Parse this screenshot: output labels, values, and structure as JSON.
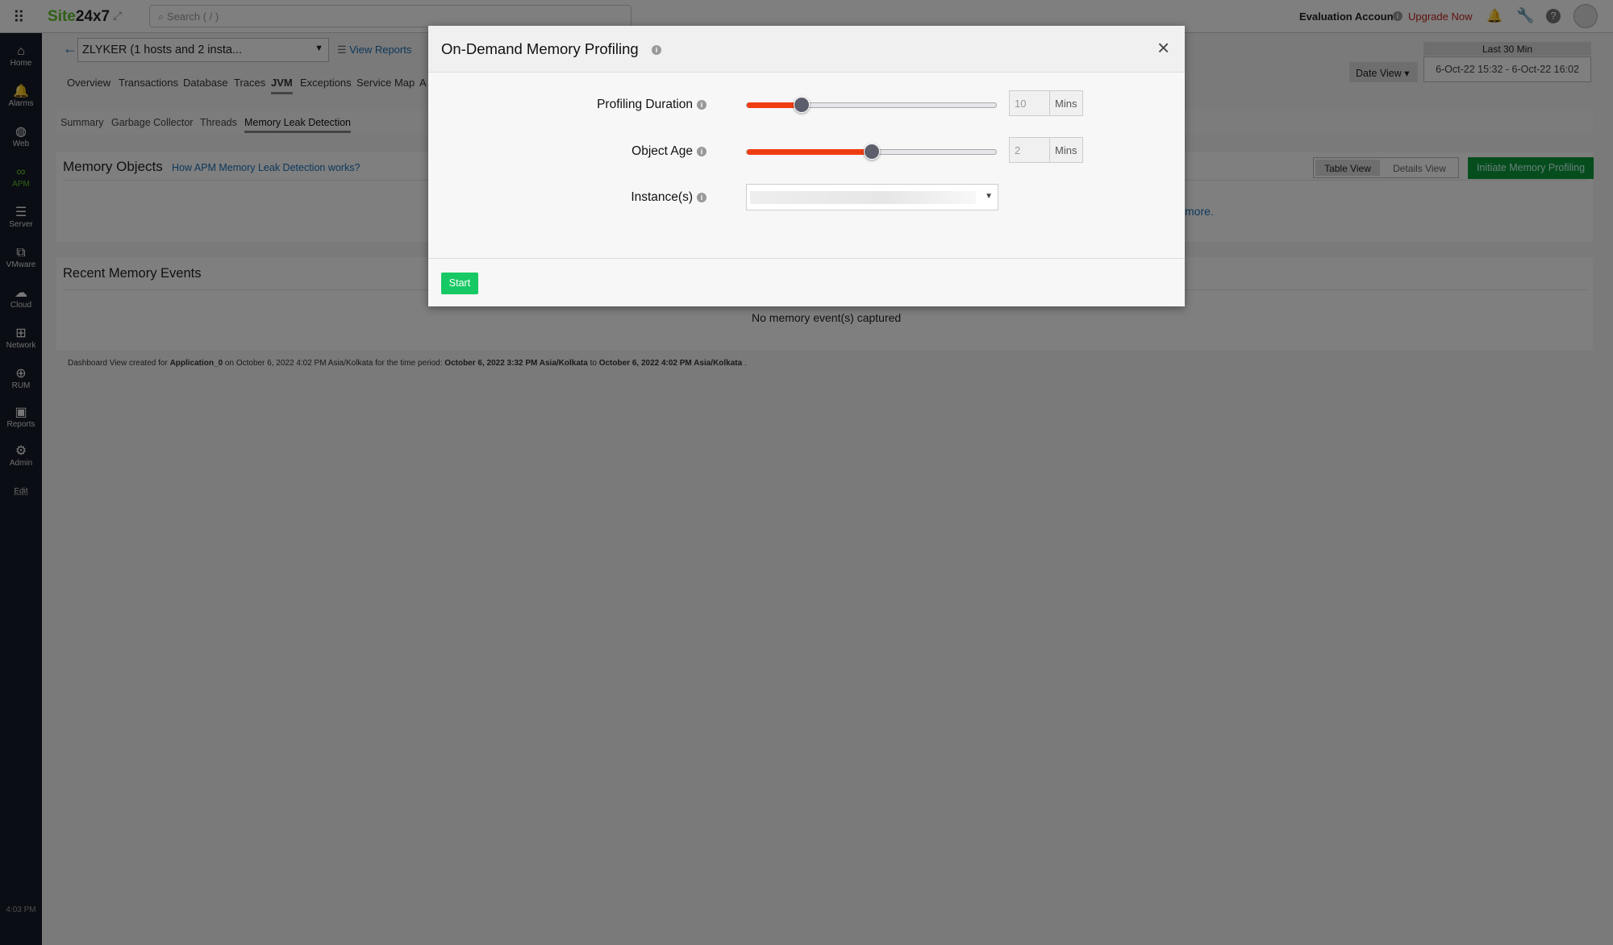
{
  "topbar": {
    "brand_a": "Site",
    "brand_b": "24x7",
    "search_placeholder": "Search ( / )",
    "account": "Evaluation Account",
    "upgrade": "Upgrade Now"
  },
  "sidebar": {
    "items": [
      {
        "label": "Home",
        "icon": "home-icon",
        "glyph": "⌂"
      },
      {
        "label": "Alarms",
        "icon": "bell-icon",
        "glyph": "🔔"
      },
      {
        "label": "Web",
        "icon": "globe-icon",
        "glyph": "◍"
      },
      {
        "label": "APM",
        "icon": "binoculars-icon",
        "glyph": "∞"
      },
      {
        "label": "Server",
        "icon": "server-icon",
        "glyph": "☰"
      },
      {
        "label": "VMware",
        "icon": "vmware-icon",
        "glyph": "⧉"
      },
      {
        "label": "Cloud",
        "icon": "cloud-icon",
        "glyph": "☁"
      },
      {
        "label": "Network",
        "icon": "network-icon",
        "glyph": "⊞"
      },
      {
        "label": "RUM",
        "icon": "rum-icon",
        "glyph": "⊕"
      },
      {
        "label": "Reports",
        "icon": "reports-icon",
        "glyph": "▣"
      },
      {
        "label": "Admin",
        "icon": "gear-icon",
        "glyph": "⚙"
      }
    ],
    "edit": "Edit",
    "time": "4:03 PM",
    "active": "APM"
  },
  "header": {
    "monitor": "ZLYKER (1 hosts and 2 insta...",
    "view_reports": "View Reports",
    "date_view": "Date View",
    "period_label": "Last 30 Min",
    "period_range": "6-Oct-22 15:32 - 6-Oct-22 16:02"
  },
  "tabs": [
    "Overview",
    "Transactions",
    "Database",
    "Traces",
    "JVM",
    "Exceptions",
    "Service Map",
    "A"
  ],
  "subtabs": [
    "Summary",
    "Garbage Collector",
    "Threads",
    "Memory Leak Detection"
  ],
  "memory_objects": {
    "title": "Memory Objects",
    "help_link": "How APM Memory Leak Detection works?",
    "more": "more.",
    "table_view": "Table View",
    "details_view": "Details View",
    "initiate": "Initiate Memory Profiling"
  },
  "recent": {
    "title": "Recent Memory Events",
    "empty": "No memory event(s) captured"
  },
  "footer": {
    "p1": "Dashboard View created for ",
    "app": "Application_0",
    "p2": " on October 6, 2022 4:02 PM Asia/Kolkata for the time period: ",
    "from": "October 6, 2022 3:32 PM Asia/Kolkata",
    "p3": " to ",
    "to": "October 6, 2022 4:02 PM Asia/Kolkata",
    "p4": " ."
  },
  "modal": {
    "title": "On-Demand Memory Profiling",
    "duration_label": "Profiling Duration",
    "duration_value": "10",
    "duration_unit": "Mins",
    "duration_slider_pct": 22,
    "age_label": "Object Age",
    "age_value": "2",
    "age_unit": "Mins",
    "age_slider_pct": 50,
    "instances_label": "Instance(s)",
    "start": "Start"
  },
  "colors": {
    "brand_green": "#5fbf2a",
    "upgrade_red": "#c0221a",
    "slider_fill": "#f03c12",
    "start_green": "#17c964",
    "initiate_green": "#0c9a3c",
    "link_blue": "#1a6fb5"
  }
}
